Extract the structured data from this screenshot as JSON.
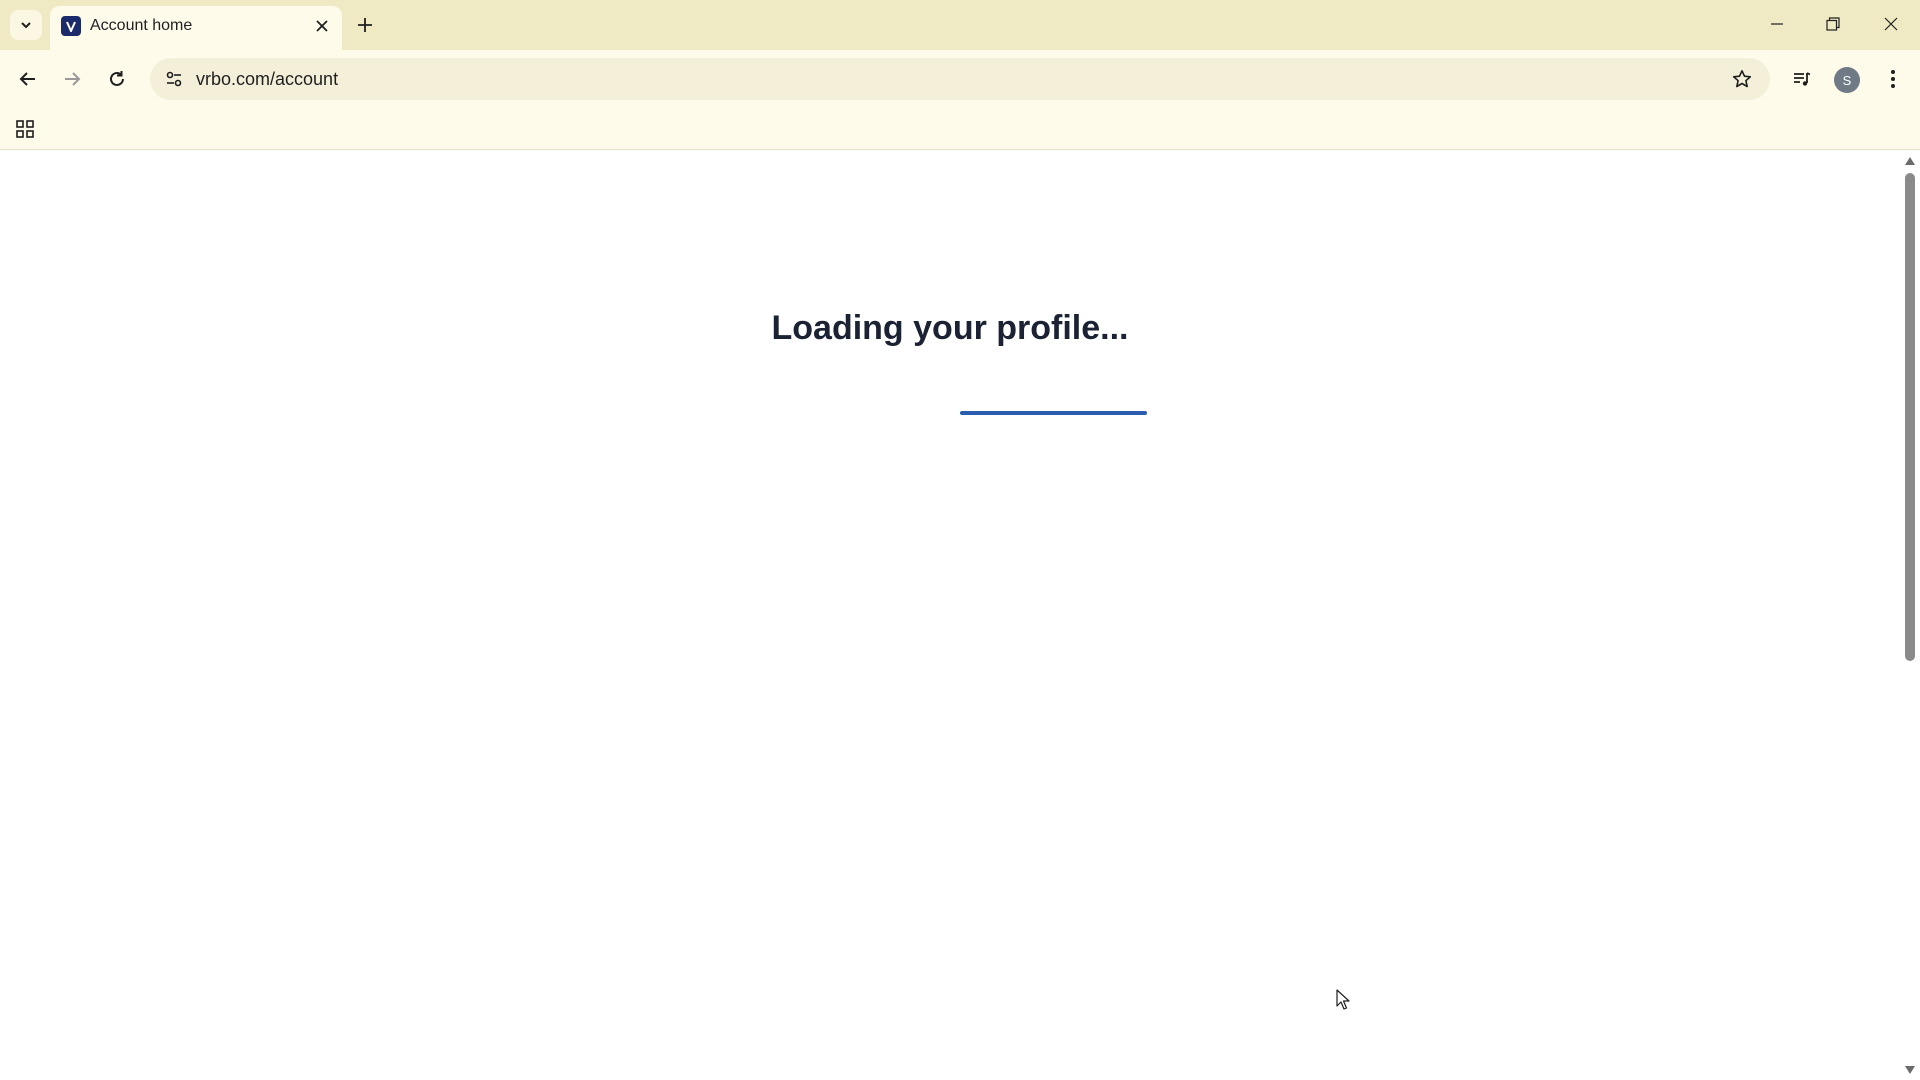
{
  "browser": {
    "tab": {
      "title": "Account home"
    },
    "address_bar": {
      "url": "vrbo.com/account"
    },
    "profile_initial": "S"
  },
  "page": {
    "loading_text": "Loading your profile...",
    "loading_progress": 0.5
  },
  "colors": {
    "tabstrip_bg": "#efe9c4",
    "toolbar_bg": "#fffbeb",
    "loading_bar": "#2a5db0",
    "title_text": "#1a2233"
  }
}
